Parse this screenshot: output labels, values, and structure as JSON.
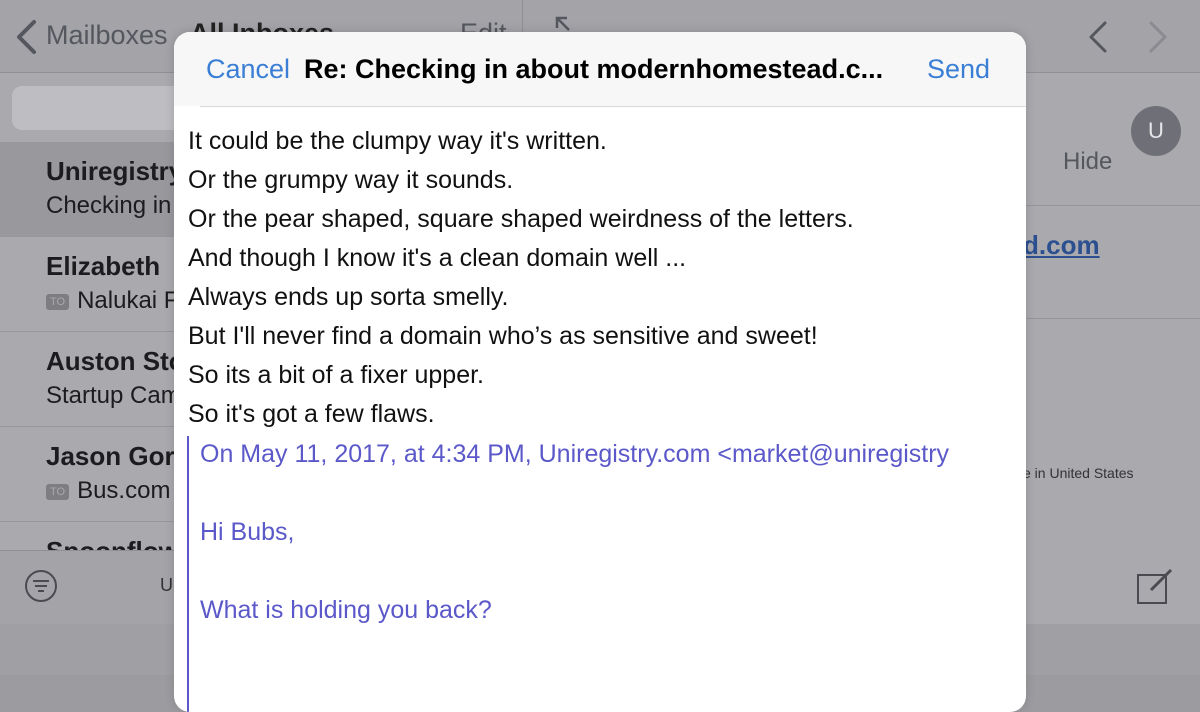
{
  "mailboxes": {
    "back_label": "Mailboxes",
    "title": "All Inboxes",
    "edit_label": "Edit",
    "items": [
      {
        "sender": "Uniregistry.com",
        "subject": "Checking in about modernhomestead.com",
        "to_badge": ""
      },
      {
        "sender": "Elizabeth",
        "subject": "Nalukai Foundation",
        "to_badge": "TO"
      },
      {
        "sender": "Auston Stokes",
        "subject": "Startup Camp",
        "to_badge": ""
      },
      {
        "sender": "Jason Gordon",
        "subject": "Bus.com",
        "to_badge": "TO"
      },
      {
        "sender": "Spoonflower",
        "subject": "",
        "to_badge": ""
      }
    ],
    "toolbar_text": "U"
  },
  "message_view": {
    "avatar_initial": "U",
    "hide_label": "Hide",
    "link_fragment": "d.com",
    "country_fragment": "e in United States"
  },
  "compose": {
    "cancel_label": "Cancel",
    "title": "Re: Checking in about modernhomestead.c...",
    "send_label": "Send",
    "body_lines": [
      "It could be the clumpy way it's written.",
      "Or the grumpy way it sounds.",
      "Or the pear shaped, square shaped weirdness of the letters.",
      "And though I know it's a clean domain well ...",
      "Always ends up sorta smelly.",
      "But I'll never find a domain who’s as sensitive and sweet!",
      "So its a bit of a fixer upper.",
      "So it's got a few flaws."
    ],
    "quote": {
      "header": "On May 11, 2017, at 4:34 PM, Uniregistry.com <market@uniregistry",
      "greeting": "Hi Bubs,",
      "question": "What is holding you back?"
    }
  },
  "colors": {
    "accent": "#3a7fd5",
    "quote": "#5b58c9"
  }
}
